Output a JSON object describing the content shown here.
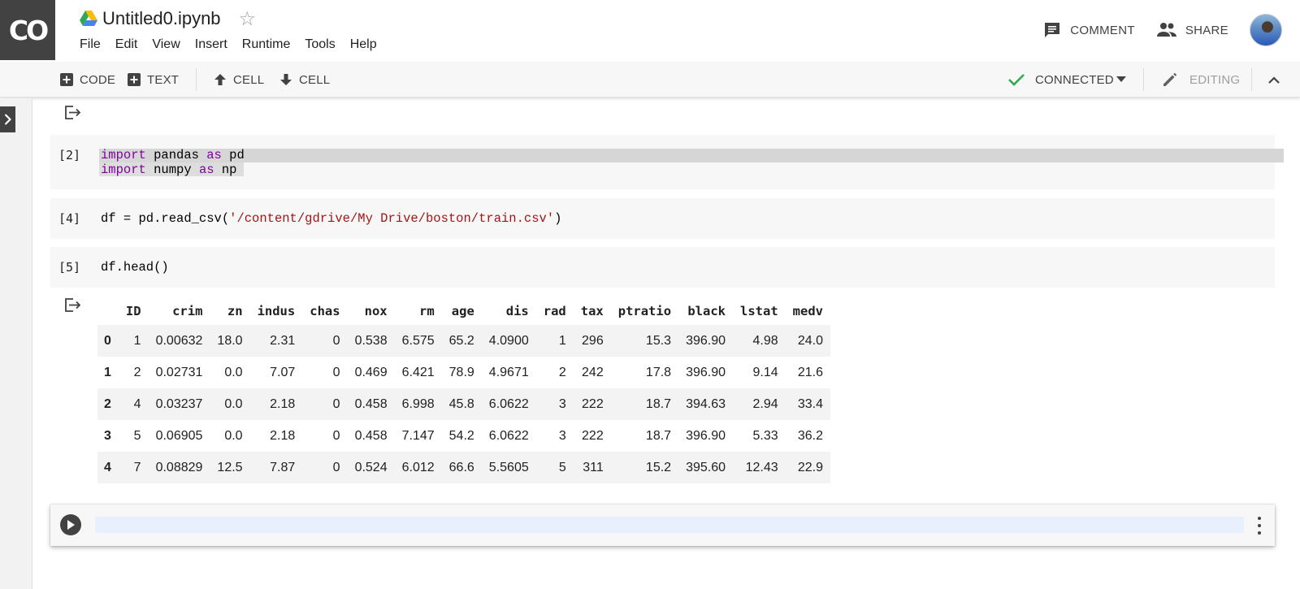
{
  "app": {
    "logo": "CO",
    "doc_title": "Untitled0.ipynb"
  },
  "menu": [
    "File",
    "Edit",
    "View",
    "Insert",
    "Runtime",
    "Tools",
    "Help"
  ],
  "header_actions": {
    "comment": "COMMENT",
    "share": "SHARE"
  },
  "toolbar": {
    "code": "CODE",
    "text": "TEXT",
    "cell_up": "CELL",
    "cell_down": "CELL",
    "status": "CONNECTED",
    "mode": "EDITING"
  },
  "cells": {
    "c2": {
      "exec": "[2]",
      "line1_kw": "import",
      "line1_mod": " pandas ",
      "line1_as": "as",
      "line1_alias": " pd",
      "line2_kw": "import",
      "line2_mod": " numpy ",
      "line2_as": "as",
      "line2_alias": " np"
    },
    "c4": {
      "exec": "[4]",
      "code_prefix": "df = pd.read_csv(",
      "code_string": "'/content/gdrive/My Drive/boston/train.csv'",
      "code_suffix": ")"
    },
    "c5": {
      "exec": "[5]",
      "code": "df.head()"
    }
  },
  "dataframe": {
    "columns": [
      "",
      "ID",
      "crim",
      "zn",
      "indus",
      "chas",
      "nox",
      "rm",
      "age",
      "dis",
      "rad",
      "tax",
      "ptratio",
      "black",
      "lstat",
      "medv"
    ],
    "rows": [
      [
        "0",
        "1",
        "0.00632",
        "18.0",
        "2.31",
        "0",
        "0.538",
        "6.575",
        "65.2",
        "4.0900",
        "1",
        "296",
        "15.3",
        "396.90",
        "4.98",
        "24.0"
      ],
      [
        "1",
        "2",
        "0.02731",
        "0.0",
        "7.07",
        "0",
        "0.469",
        "6.421",
        "78.9",
        "4.9671",
        "2",
        "242",
        "17.8",
        "396.90",
        "9.14",
        "21.6"
      ],
      [
        "2",
        "4",
        "0.03237",
        "0.0",
        "2.18",
        "0",
        "0.458",
        "6.998",
        "45.8",
        "6.0622",
        "3",
        "222",
        "18.7",
        "394.63",
        "2.94",
        "33.4"
      ],
      [
        "3",
        "5",
        "0.06905",
        "0.0",
        "2.18",
        "0",
        "0.458",
        "7.147",
        "54.2",
        "6.0622",
        "3",
        "222",
        "18.7",
        "396.90",
        "5.33",
        "36.2"
      ],
      [
        "4",
        "7",
        "0.08829",
        "12.5",
        "7.87",
        "0",
        "0.524",
        "6.012",
        "66.6",
        "5.5605",
        "5",
        "311",
        "15.2",
        "395.60",
        "12.43",
        "22.9"
      ]
    ]
  },
  "icons": {
    "drive": "google-drive-icon",
    "star": "star-icon",
    "comment": "comment-icon",
    "share": "people-icon",
    "status": "check-icon",
    "mode": "pencil-icon"
  },
  "colors": {
    "logo_bg": "#424242",
    "connected_check": "#34a853",
    "keyword": "#8000a0",
    "string": "#a31515",
    "cell_bg": "#f7f7f7",
    "editor_focus": "#e8f0fe"
  }
}
